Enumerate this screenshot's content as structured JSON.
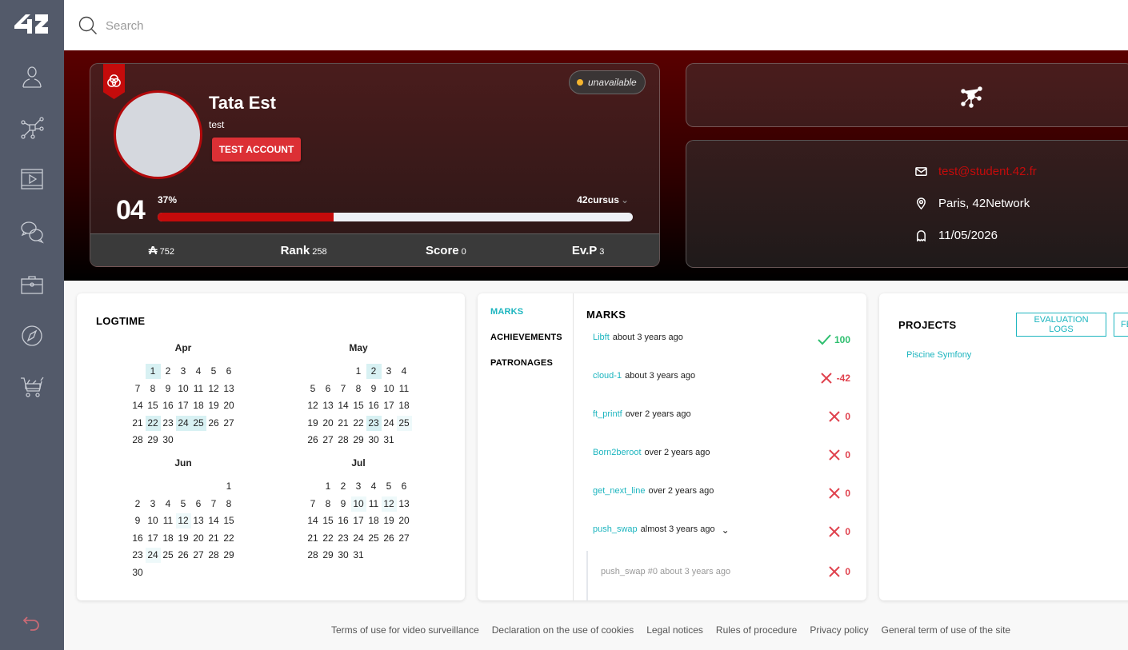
{
  "sidebar": {
    "logo": "42",
    "items": [
      {
        "name": "profile",
        "icon": "user-icon"
      },
      {
        "name": "holy-graph",
        "icon": "network-icon"
      },
      {
        "name": "elearning",
        "icon": "video-icon"
      },
      {
        "name": "forum",
        "icon": "chat-icon"
      },
      {
        "name": "companies",
        "icon": "briefcase-icon"
      },
      {
        "name": "exam",
        "icon": "compass-icon"
      },
      {
        "name": "shop",
        "icon": "cart-icon"
      }
    ],
    "logout_icon": "logout-icon"
  },
  "search": {
    "placeholder": "Search",
    "value": ""
  },
  "profile": {
    "name": "Tata Est",
    "login": "test",
    "badge_button": "TEST ACCOUNT",
    "status": "unavailable",
    "status_color": "#f5b52e",
    "level": "04",
    "level_percent_label": "37%",
    "level_progress": 0.37,
    "cursus": "42cursus",
    "stats": [
      {
        "label": "₳",
        "value": "752"
      },
      {
        "label": "Rank",
        "value": "258"
      },
      {
        "label": "Score",
        "value": "0"
      },
      {
        "label": "Ev.P",
        "value": "3"
      }
    ]
  },
  "info": {
    "email": "test@student.42.fr",
    "location": "Paris, 42Network",
    "date": "11/05/2026"
  },
  "logtime": {
    "title": "LOGTIME",
    "months": [
      {
        "name": "Apr",
        "offset": 1,
        "days": 30,
        "active": [
          1,
          22,
          24,
          25
        ],
        "light": []
      },
      {
        "name": "May",
        "offset": 3,
        "days": 31,
        "active": [
          2,
          23
        ],
        "light": [
          25
        ]
      },
      {
        "name": "Jun",
        "offset": 6,
        "days": 30,
        "active": [],
        "light": [
          12,
          24
        ]
      },
      {
        "name": "Jul",
        "offset": 1,
        "days": 31,
        "active": [],
        "light": [
          10,
          12
        ]
      }
    ]
  },
  "marks": {
    "tabs": [
      "MARKS",
      "ACHIEVEMENTS",
      "PATRONAGES"
    ],
    "title": "MARKS",
    "items": [
      {
        "project": "Libft",
        "when": "about 3 years ago",
        "score": "100",
        "status": "pass"
      },
      {
        "project": "cloud-1",
        "when": "about 3 years ago",
        "score": "-42",
        "status": "fail"
      },
      {
        "project": "ft_printf",
        "when": "over 2 years ago",
        "score": "0",
        "status": "fail"
      },
      {
        "project": "Born2beroot",
        "when": "over 2 years ago",
        "score": "0",
        "status": "fail"
      },
      {
        "project": "get_next_line",
        "when": "over 2 years ago",
        "score": "0",
        "status": "fail"
      },
      {
        "project": "push_swap",
        "when": "almost 3 years ago",
        "score": "0",
        "status": "fail",
        "expandable": true
      }
    ],
    "sub_item": {
      "label": "push_swap #0 about 3 years ago",
      "score": "0",
      "status": "fail"
    }
  },
  "projects": {
    "title": "PROJECTS",
    "buttons": [
      "EVALUATION LOGS",
      "FE"
    ],
    "items": [
      "Piscine Symfony"
    ]
  },
  "footer": {
    "links": [
      "Terms of use for video surveillance",
      "Declaration on the use of cookies",
      "Legal notices",
      "Rules of procedure",
      "Privacy policy",
      "General term of use of the site"
    ]
  },
  "colors": {
    "accent": "#1db5bf",
    "brand_red": "#c40b0b",
    "pass": "#2ebf6f",
    "fail": "#e0424e"
  }
}
